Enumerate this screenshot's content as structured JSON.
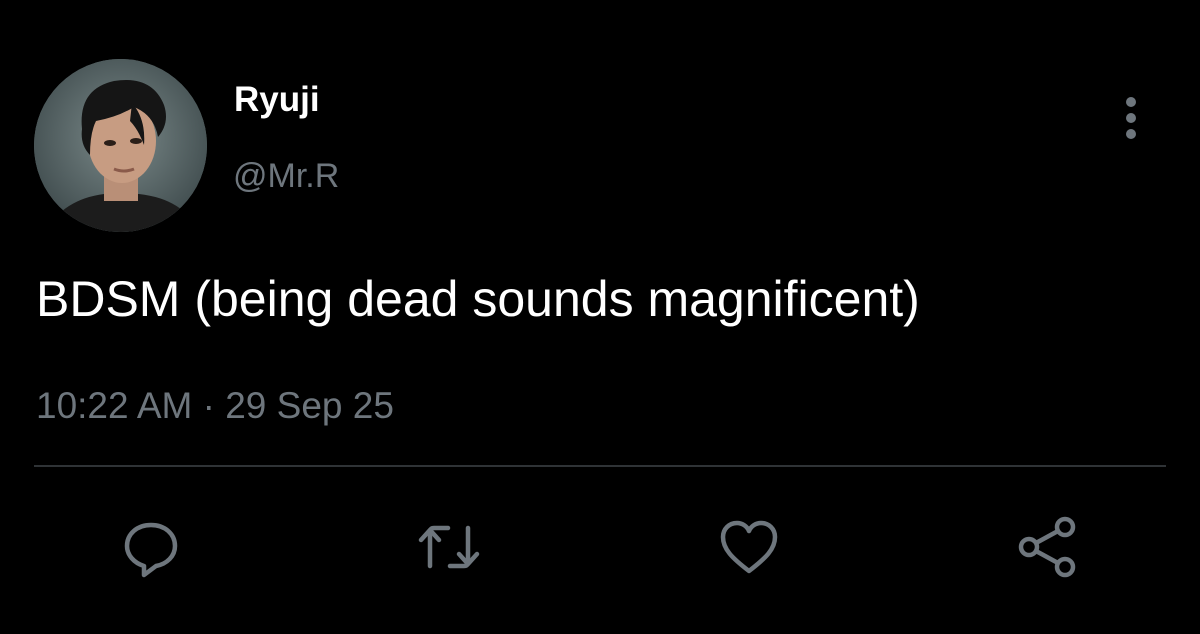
{
  "tweet": {
    "author": {
      "display_name": "Ryuji",
      "handle": "@Mr.R"
    },
    "text": "BDSM (being dead sounds magnificent)",
    "timestamp": "10:22 AM · 29 Sep 25"
  },
  "actions": [
    {
      "name": "reply",
      "icon": "reply-icon"
    },
    {
      "name": "retweet",
      "icon": "retweet-icon"
    },
    {
      "name": "like",
      "icon": "heart-icon"
    },
    {
      "name": "share",
      "icon": "share-icon"
    }
  ],
  "colors": {
    "background": "#000000",
    "primary_text": "#ffffff",
    "secondary_text": "#6e767d",
    "icon": "#6e767d",
    "divider": "#2f3336"
  }
}
